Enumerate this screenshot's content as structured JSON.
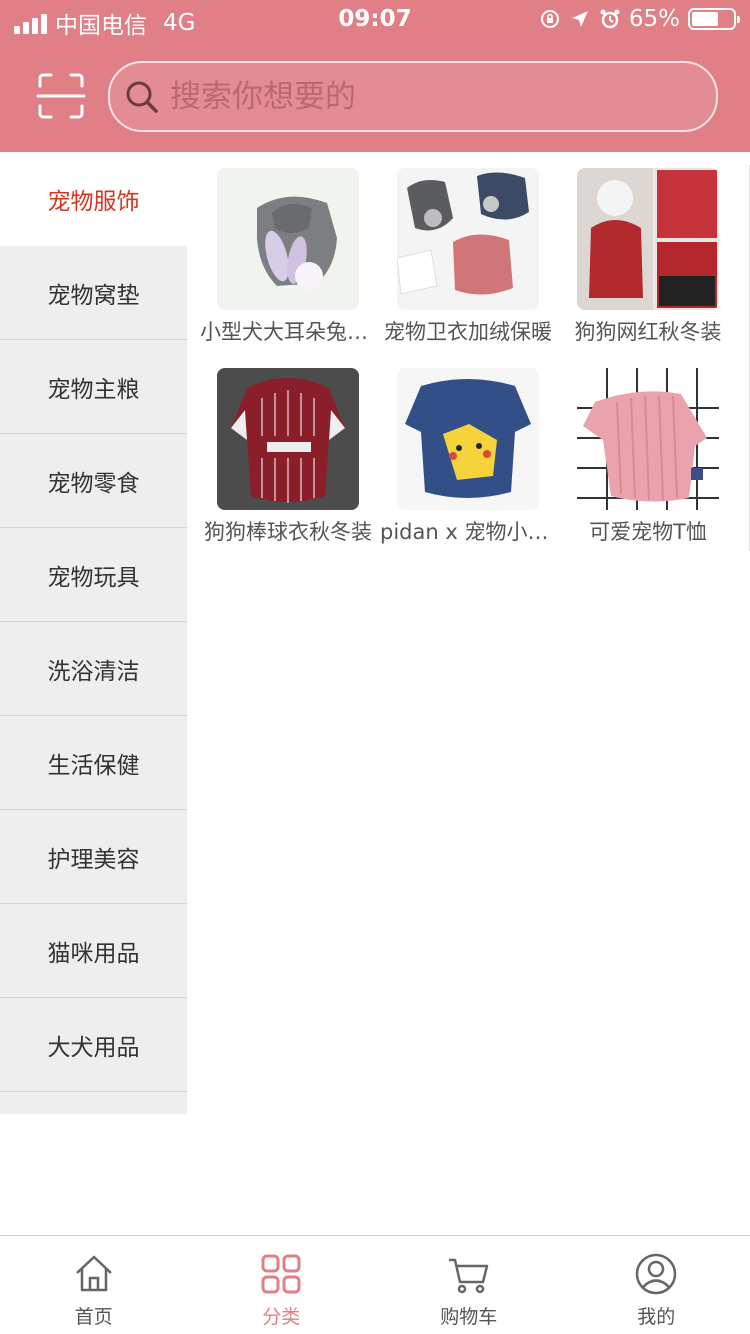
{
  "status_bar": {
    "carrier": "中国电信",
    "network": "4G",
    "time": "09:07",
    "battery": "65%",
    "battery_level": 0.65
  },
  "search": {
    "placeholder": "搜索你想要的",
    "icon": "search-icon"
  },
  "header": {
    "scan_icon": "scan-icon",
    "background": "#e07f86"
  },
  "sidebar": {
    "active_color": "#d9341f",
    "items": [
      {
        "label": "宠物服饰"
      },
      {
        "label": "宠物窝垫"
      },
      {
        "label": "宠物主粮"
      },
      {
        "label": "宠物零食"
      },
      {
        "label": "宠物玩具"
      },
      {
        "label": "洗浴清洁"
      },
      {
        "label": "生活保健"
      },
      {
        "label": "护理美容"
      },
      {
        "label": "猫咪用品"
      },
      {
        "label": "大犬用品"
      }
    ]
  },
  "products": [
    {
      "name": "小型犬大耳朵兔子卫衣"
    },
    {
      "name": "宠物卫衣加绒保暖"
    },
    {
      "name": "狗狗网红秋冬装"
    },
    {
      "name": "狗狗棒球衣秋冬装"
    },
    {
      "name": "pidan x 宠物小精灵"
    },
    {
      "name": "可爱宠物T恤"
    }
  ],
  "tabbar": {
    "active_color": "#e07f86",
    "tabs": [
      {
        "label": "首页",
        "icon": "home-icon"
      },
      {
        "label": "分类",
        "icon": "category-icon"
      },
      {
        "label": "购物车",
        "icon": "cart-icon"
      },
      {
        "label": "我的",
        "icon": "profile-icon"
      }
    ]
  }
}
